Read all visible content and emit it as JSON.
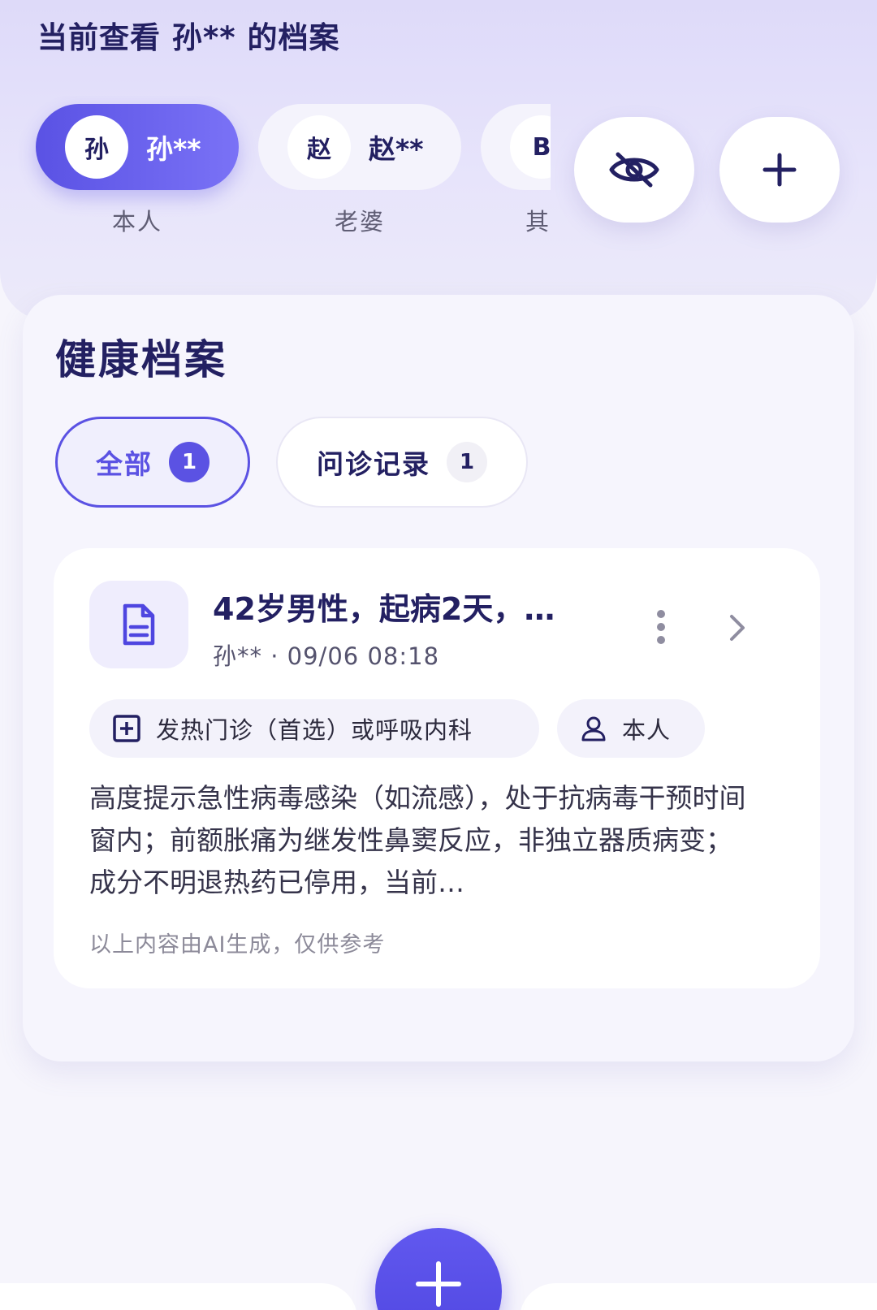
{
  "header": {
    "viewing_title": "当前查看 孙** 的档案"
  },
  "profiles": [
    {
      "avatar_char": "孙",
      "name": "孙**",
      "relation": "本人",
      "active": true
    },
    {
      "avatar_char": "赵",
      "name": "赵**",
      "relation": "老婆",
      "active": false
    },
    {
      "avatar_char": "B",
      "name": "",
      "relation": "其",
      "active": false
    }
  ],
  "header_actions": {
    "hide_icon": "eye-off-icon",
    "add_icon": "plus-icon"
  },
  "health_records": {
    "title": "健康档案",
    "filters": [
      {
        "label": "全部",
        "count": "1",
        "selected": true
      },
      {
        "label": "问诊记录",
        "count": "1",
        "selected": false
      }
    ],
    "record": {
      "icon": "document-icon",
      "title": "42岁男性，起病2天，…",
      "meta": "孙** · 09/06 08:18",
      "department_tag": "发热门诊（首选）或呼吸内科",
      "person_tag": "本人",
      "summary": "高度提示急性病毒感染（如流感），处于抗病毒干预时间窗内；前额胀痛为继发性鼻窦反应，非独立器质病变；成分不明退热药已停用，当前…",
      "ai_note": "以上内容由AI生成，仅供参考"
    }
  },
  "colors": {
    "accent": "#5b52e3",
    "title_text": "#232062",
    "header_band": "#dedaf9",
    "page_bg": "#f6f5fc"
  }
}
